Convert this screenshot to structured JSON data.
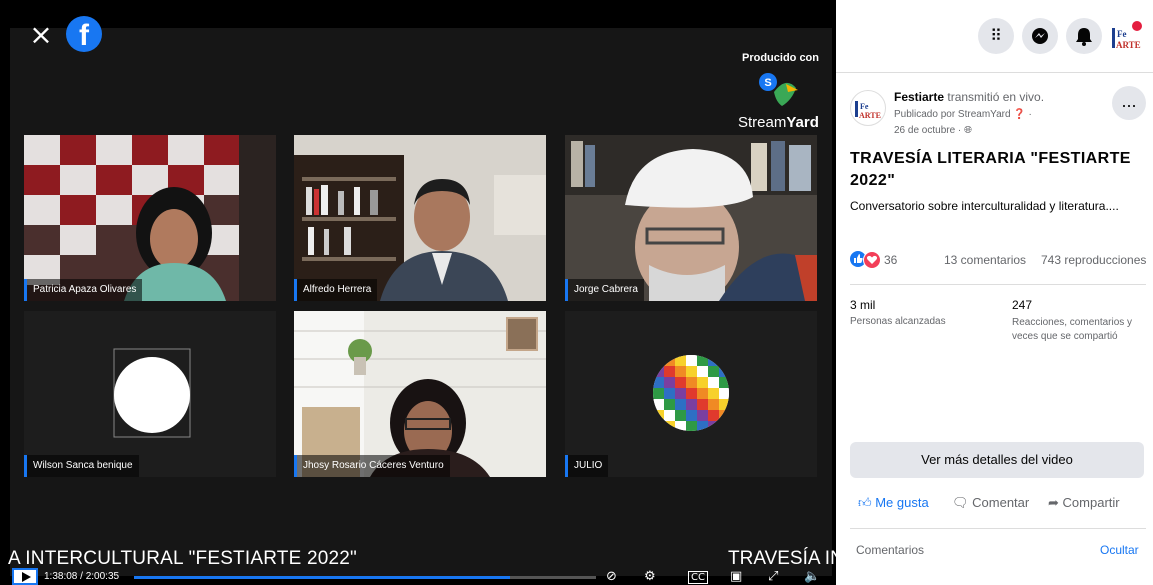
{
  "header": {
    "close_icon": "close-icon",
    "brand_icon": "facebook-logo-icon"
  },
  "overlay": {
    "produced_with": "Producido con",
    "streamyard_a": "Stream",
    "streamyard_b": "Yard",
    "ticker_left": "A INTERCULTURAL \"FESTIARTE 2022\"",
    "ticker_right": "TRAVESÍA INT"
  },
  "participants": [
    {
      "name": "Patricia Apaza Olivares"
    },
    {
      "name": "Alfredo Herrera"
    },
    {
      "name": "Jorge Cabrera"
    },
    {
      "name": "Wilson Sanca benique"
    },
    {
      "name": "Jhosy Rosario Cáceres Venturo"
    },
    {
      "name": "JULIO"
    }
  ],
  "player": {
    "time": "1:38:08 / 2:00:35",
    "progress": 0.814
  },
  "topbar": {
    "icons": [
      "apps-grid-icon",
      "messenger-icon",
      "notifications-bell-icon",
      "page-avatar"
    ]
  },
  "post": {
    "page_name": "Festiarte",
    "action": " transmitió en vivo.",
    "published_by": "Publicado por StreamYard",
    "date": "26 de octubre ·",
    "more": "...",
    "title": "TRAVESÍA LITERARIA \"FESTIARTE 2022\"",
    "description": "Conversatorio sobre interculturalidad y literatura....",
    "reaction_count": "36",
    "comments": "13 comentarios",
    "views": "743 reproducciones",
    "reach_value": "3 mil",
    "reach_label": "Personas alcanzadas",
    "engagement_value": "247",
    "engagement_label": "Reacciones, comentarios y veces que se compartió",
    "details_button": "Ver más detalles del video",
    "like": "Me gusta",
    "comment": "Comentar",
    "share": "Compartir",
    "comments_header": "Comentarios",
    "hide": "Ocultar"
  },
  "colors": {
    "accent": "#1877f2",
    "love": "#f33e58"
  }
}
